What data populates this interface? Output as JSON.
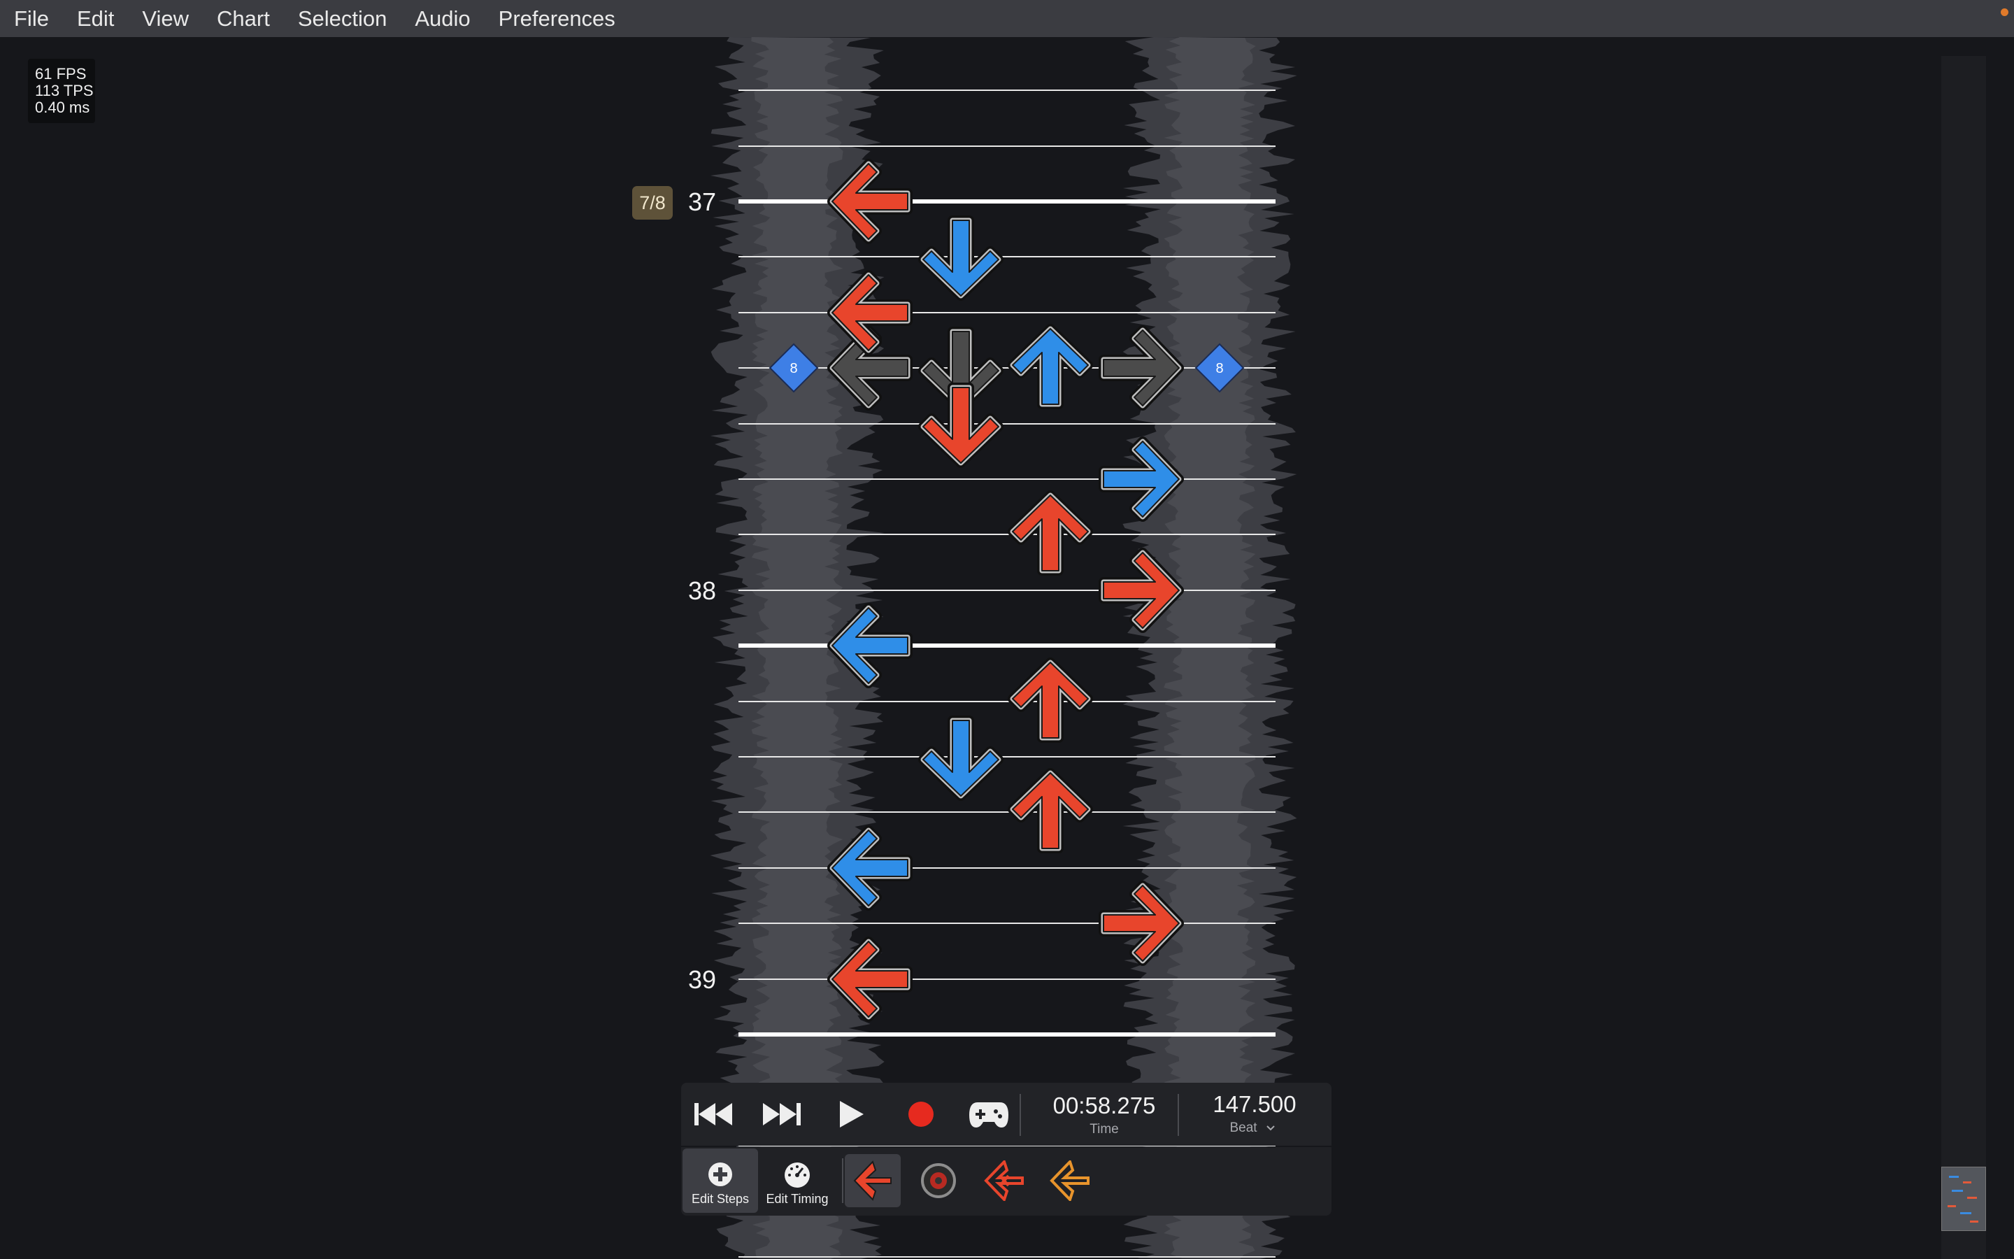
{
  "menu": {
    "items": [
      "File",
      "Edit",
      "View",
      "Chart",
      "Selection",
      "Audio",
      "Preferences"
    ]
  },
  "perf": {
    "fps": "61 FPS",
    "tps": "113 TPS",
    "frame_time": "0.40 ms"
  },
  "chart": {
    "beat_badge": "7/8",
    "measures": [
      "37",
      "38",
      "39"
    ],
    "stop_markers": [
      "8",
      "8"
    ],
    "lanes": [
      "left",
      "down",
      "up",
      "right"
    ],
    "note_colors": {
      "red": "#e8452c",
      "blue": "#2f8ee8",
      "receptor": "#4b4b4b"
    },
    "notes": [
      {
        "row": 0,
        "lane": "left",
        "color": "red"
      },
      {
        "row": 1,
        "lane": "down",
        "color": "blue"
      },
      {
        "row": 2,
        "lane": "left",
        "color": "red"
      },
      {
        "row": 3,
        "lane": "up",
        "color": "blue"
      },
      {
        "row": 4,
        "lane": "down",
        "color": "red"
      },
      {
        "row": 5,
        "lane": "right",
        "color": "blue"
      },
      {
        "row": 6,
        "lane": "up",
        "color": "red"
      },
      {
        "row": 7,
        "lane": "right",
        "color": "red"
      },
      {
        "row": 8,
        "lane": "left",
        "color": "blue"
      },
      {
        "row": 9,
        "lane": "up",
        "color": "red"
      },
      {
        "row": 10,
        "lane": "down",
        "color": "blue"
      },
      {
        "row": 11,
        "lane": "up",
        "color": "red"
      },
      {
        "row": 12,
        "lane": "left",
        "color": "blue"
      },
      {
        "row": 13,
        "lane": "right",
        "color": "red"
      },
      {
        "row": 14,
        "lane": "left",
        "color": "red"
      }
    ]
  },
  "transport": {
    "time_value": "00:58.275",
    "time_label": "Time",
    "beat_value": "147.500",
    "beat_label": "Beat"
  },
  "tools": {
    "edit_steps": "Edit Steps",
    "edit_timing": "Edit Timing"
  }
}
